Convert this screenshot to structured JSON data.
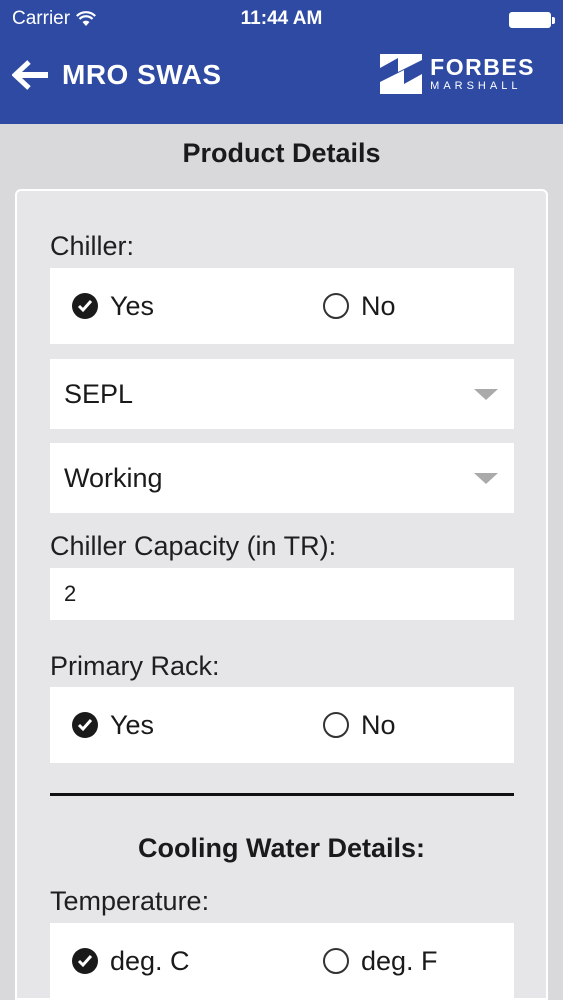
{
  "status_bar": {
    "carrier": "Carrier",
    "time": "11:44 AM"
  },
  "nav": {
    "back_icon": "back-arrow-icon",
    "title": "MRO SWAS",
    "logo": {
      "line1": "FORBES",
      "line2": "MARSHALL"
    }
  },
  "page_title": "Product Details",
  "chiller": {
    "label": "Chiller:",
    "options": [
      "Yes",
      "No"
    ],
    "selected": "Yes",
    "make": "SEPL",
    "status": "Working"
  },
  "chiller_capacity": {
    "label": "Chiller Capacity (in TR):",
    "value": "2"
  },
  "primary_rack": {
    "label": "Primary Rack:",
    "options": [
      "Yes",
      "No"
    ],
    "selected": "Yes"
  },
  "cooling_water": {
    "title": "Cooling Water Details:",
    "temperature_label": "Temperature:",
    "units": [
      "deg. C",
      "deg. F"
    ],
    "selected": "deg. C"
  },
  "colors": {
    "header": "#2e4aa3",
    "background": "#d9d9db",
    "card": "#e6e6e8"
  }
}
